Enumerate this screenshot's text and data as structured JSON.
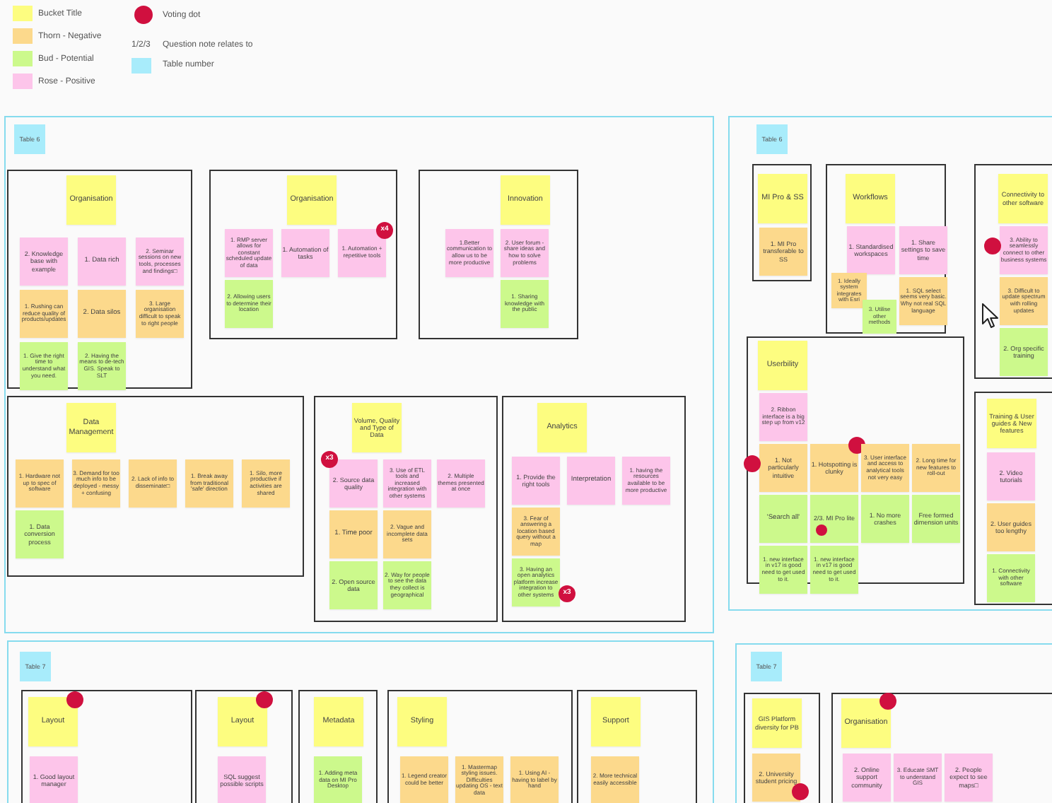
{
  "legend": {
    "items": [
      {
        "label": "Bucket Title",
        "color": "#fdfd80"
      },
      {
        "label": "Thorn - Negative",
        "color": "#fcd98c"
      },
      {
        "label": "Bud - Potential",
        "color": "#ccf98c"
      },
      {
        "label": "Rose - Positive",
        "color": "#fdc5ea"
      }
    ],
    "vote": {
      "label": "Voting dot"
    },
    "question": {
      "mark": "1/2/3",
      "label": "Question note relates to"
    },
    "table": {
      "label": "Table number",
      "color": "#a8ecfb"
    }
  },
  "tables": [
    {
      "label": "Table 6",
      "frames": [
        {
          "title": {
            "text": "Organisation"
          },
          "notes": [
            {
              "kind": "rose",
              "text": "2. Knowledge base with example"
            },
            {
              "kind": "rose",
              "text": "1. Data rich"
            },
            {
              "kind": "rose",
              "text": "2. Seminar sessions on new tools, processes and findings□"
            },
            {
              "kind": "thorn",
              "text": "1. Rushing can reduce quality of products/updates"
            },
            {
              "kind": "thorn",
              "text": "2. Data silos"
            },
            {
              "kind": "thorn",
              "text": "3. Large organisation difficult to speak to right people"
            },
            {
              "kind": "bud",
              "text": "1. Give the right time to understand what you need."
            },
            {
              "kind": "bud",
              "text": "2. Having the means to de-tech GIS. Speak to SLT"
            }
          ]
        },
        {
          "title": {
            "text": "Organisation"
          },
          "notes": [
            {
              "kind": "rose",
              "text": "1. RMP server allows for constant scheduled update of data"
            },
            {
              "kind": "rose",
              "text": "1. Automation of tasks"
            },
            {
              "kind": "rose",
              "text": "1. Automation + repetitive tools",
              "voted": true,
              "badge": "x4"
            },
            {
              "kind": "bud",
              "text": "2. Allowing users to determine their location"
            }
          ]
        },
        {
          "title": {
            "text": "Innovation"
          },
          "notes": [
            {
              "kind": "rose",
              "text": "1.Better communication to allow us to be more productive"
            },
            {
              "kind": "rose",
              "text": "2. User forum - share ideas and how to solve problems"
            },
            {
              "kind": "bud",
              "text": "1. Sharing knowledge with the public"
            }
          ]
        },
        {
          "title": {
            "text": "Data Management"
          },
          "notes": [
            {
              "kind": "thorn",
              "text": "1. Hardware not up to spec of software"
            },
            {
              "kind": "thorn",
              "text": "3. Demand for too much info to be deployed - messy + confusing"
            },
            {
              "kind": "thorn",
              "text": "2. Lack of info to disseminate□"
            },
            {
              "kind": "thorn",
              "text": "1. Break away from traditional 'safe' direction"
            },
            {
              "kind": "thorn",
              "text": "1. Silo, more productive if activities are shared"
            },
            {
              "kind": "bud",
              "text": "1. Data conversion process"
            }
          ]
        },
        {
          "title": {
            "text": "Volume, Quality and Type of Data"
          },
          "notes": [
            {
              "kind": "rose",
              "text": "2. Source data quality",
              "voted": true,
              "badge": "x3"
            },
            {
              "kind": "rose",
              "text": "3. Use of ETL tools and increased integration with other systems"
            },
            {
              "kind": "rose",
              "text": "2. Multiple themes presented at once"
            },
            {
              "kind": "thorn",
              "text": "1. Time poor"
            },
            {
              "kind": "thorn",
              "text": "2. Vague and incomplete data sets"
            },
            {
              "kind": "bud",
              "text": "2. Open source data"
            },
            {
              "kind": "bud",
              "text": "2. Way for people to see the data they collect is geographical"
            }
          ]
        },
        {
          "title": {
            "text": "Analytics"
          },
          "notes": [
            {
              "kind": "rose",
              "text": "1. Provide the right tools"
            },
            {
              "kind": "rose",
              "text": "Interpretation"
            },
            {
              "kind": "rose",
              "text": "1. having the resources available to be more productive"
            },
            {
              "kind": "thorn",
              "text": "3. Fear of answering a location based query without a map"
            },
            {
              "kind": "bud",
              "text": "3. Having an open analytics platform increase integration to other systems",
              "voted": true,
              "badge": "x3"
            }
          ]
        }
      ]
    },
    {
      "label": "Table 6",
      "frames": [
        {
          "title": {
            "text": "MI Pro & SS"
          },
          "notes": [
            {
              "kind": "thorn",
              "text": "1. MI Pro transferable to SS"
            }
          ]
        },
        {
          "title": {
            "text": "Workflows"
          },
          "notes": [
            {
              "kind": "rose",
              "text": "1. Standardised workspaces"
            },
            {
              "kind": "rose",
              "text": "1. Share settings to save time"
            },
            {
              "kind": "thorn",
              "text": "1. Ideally system integrates with Esri"
            },
            {
              "kind": "bud",
              "text": "3. Utilise other methods"
            },
            {
              "kind": "thorn",
              "text": "1. SQL select seems very basic. Why not real SQL language"
            }
          ]
        },
        {
          "title": {
            "text": "Connectivity to other software"
          },
          "notes": [
            {
              "kind": "rose",
              "text": "3. Ability to seamlessly connect to other business systems",
              "voted": true
            },
            {
              "kind": "thorn",
              "text": "3. Difficult to update spectrum with rolling updates"
            },
            {
              "kind": "bud",
              "text": "2. Org specific training"
            }
          ]
        },
        {
          "title": {
            "text": "Userbility"
          },
          "notes": [
            {
              "kind": "rose",
              "text": "2. Ribbon interface is a big step up from v12"
            },
            {
              "kind": "thorn",
              "text": "1. Not particularly intuitive",
              "voted": true
            },
            {
              "kind": "thorn",
              "text": "1. Hotspotting is clunky",
              "voted": true
            },
            {
              "kind": "thorn",
              "text": "3. User interface and access to analytical tools not very easy"
            },
            {
              "kind": "thorn",
              "text": "2. Long time for new features to roll-out"
            },
            {
              "kind": "bud",
              "text": "'Search all'"
            },
            {
              "kind": "bud",
              "text": "2/3. MI Pro lite",
              "voted": true
            },
            {
              "kind": "bud",
              "text": "1. No more crashes"
            },
            {
              "kind": "bud",
              "text": "Free formed dimension units"
            },
            {
              "kind": "bud",
              "text": "1. new interface in v17 is good need to get used to it."
            },
            {
              "kind": "bud",
              "text": "1. new interface in v17 is good need to get used to it."
            }
          ]
        },
        {
          "title": {
            "text": "Training & User guides & New features"
          },
          "notes": [
            {
              "kind": "rose",
              "text": "2. Video tutorials"
            },
            {
              "kind": "thorn",
              "text": "2. User guides too lengthy"
            },
            {
              "kind": "bud",
              "text": "1. Connectivity with other software"
            }
          ]
        }
      ]
    },
    {
      "label": "Table 7",
      "frames": [
        {
          "title": {
            "text": "Layout",
            "voted": true
          },
          "notes": [
            {
              "kind": "rose",
              "text": "1. Good layout manager"
            }
          ]
        },
        {
          "title": {
            "text": "Layout",
            "voted": true
          },
          "notes": [
            {
              "kind": "rose",
              "text": "SQL suggest possible scripts"
            }
          ]
        },
        {
          "title": {
            "text": "Metadata"
          },
          "notes": [
            {
              "kind": "bud",
              "text": "1. Adding meta data on MI Pro Desktop"
            }
          ]
        },
        {
          "title": {
            "text": "Styling"
          },
          "notes": [
            {
              "kind": "thorn",
              "text": "1. Legend creator could be better"
            },
            {
              "kind": "thorn",
              "text": "1. Mastermap styling issues. Difficulties updating OS - text data"
            },
            {
              "kind": "thorn",
              "text": "1. Using AI - having to label by hand"
            }
          ]
        },
        {
          "title": {
            "text": "Support"
          },
          "notes": [
            {
              "kind": "thorn",
              "text": "2. More technical easily accessible"
            }
          ]
        }
      ]
    },
    {
      "label": "Table 7",
      "frames": [
        {
          "title": {
            "text": "GIS Platform diversity for PB"
          },
          "notes": [
            {
              "kind": "thorn",
              "text": "2. University student pricing",
              "voted": true
            }
          ]
        },
        {
          "title": {
            "text": "Organisation",
            "voted": true
          },
          "notes": [
            {
              "kind": "rose",
              "text": "2. Online support community"
            },
            {
              "kind": "rose",
              "text": "3. Educate SMT to understand GIS"
            },
            {
              "kind": "rose",
              "text": "2. People expect to see maps□"
            }
          ]
        }
      ]
    }
  ]
}
